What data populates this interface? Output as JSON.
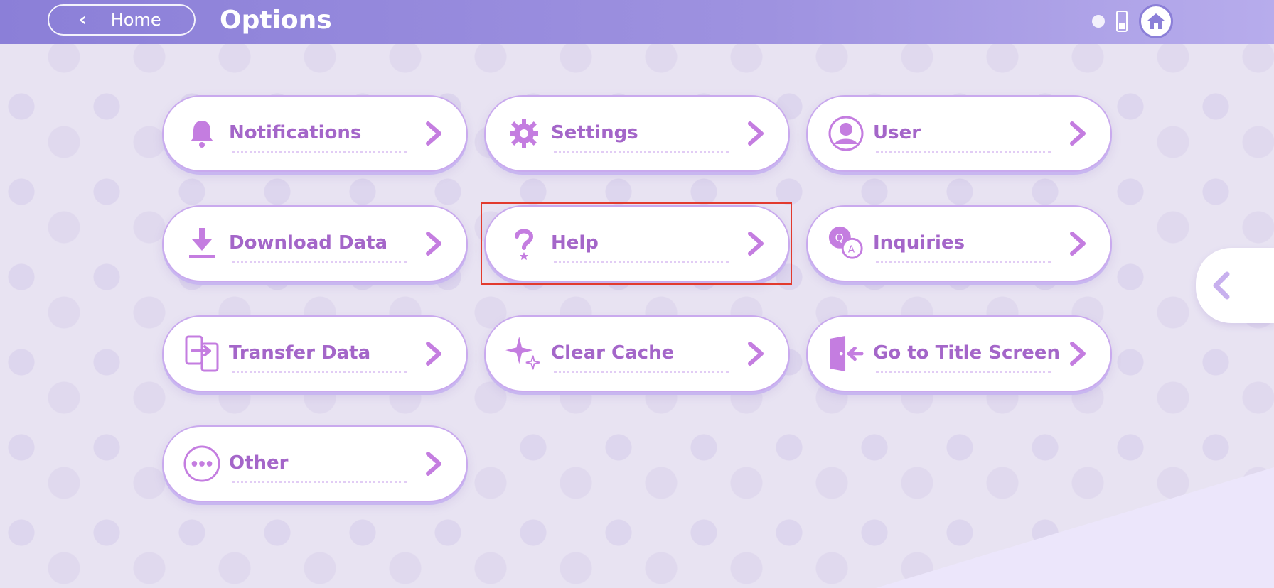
{
  "header": {
    "back_label": "Home",
    "title": "Options",
    "icons": [
      "robot-icon",
      "battery-icon",
      "home-icon"
    ]
  },
  "menu": [
    {
      "label": "Notifications",
      "icon": "bell-icon"
    },
    {
      "label": "Settings",
      "icon": "gear-icon"
    },
    {
      "label": "User",
      "icon": "user-icon"
    },
    {
      "label": "Download Data",
      "icon": "download-icon"
    },
    {
      "label": "Help",
      "icon": "help-icon"
    },
    {
      "label": "Inquiries",
      "icon": "qa-icon"
    },
    {
      "label": "Transfer Data",
      "icon": "transfer-icon"
    },
    {
      "label": "Clear Cache",
      "icon": "sparkle-icon"
    },
    {
      "label": "Go to Title Screen",
      "icon": "exit-door-icon"
    },
    {
      "label": "Other",
      "icon": "more-icon"
    }
  ],
  "colors": {
    "accent": "#a466c9",
    "header": "#8b7fd8",
    "highlight": "#e23a2e"
  }
}
